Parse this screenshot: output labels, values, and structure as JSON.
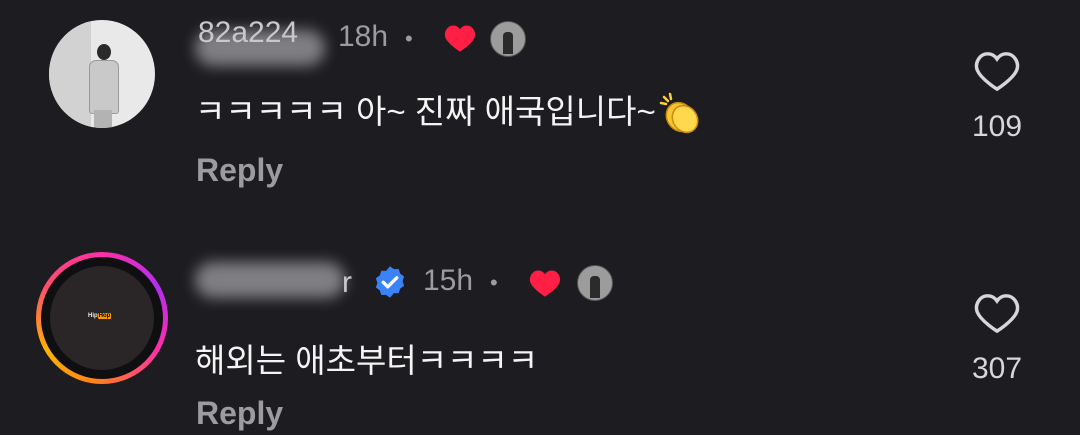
{
  "comments": [
    {
      "username_fragment": "82a224",
      "time": "18h",
      "separator": "•",
      "text": "ㅋㅋㅋㅋㅋ 아~ 진짜 애국입니다~",
      "emoji": "clapping-hands",
      "reply_label": "Reply",
      "likes": "109"
    },
    {
      "username_fragment": "r",
      "time": "15h",
      "separator": "•",
      "verified": true,
      "avatar_logo": [
        "Hip",
        "Hop"
      ],
      "text": "해외는 애초부터ㅋㅋㅋㅋ",
      "reply_label": "Reply",
      "likes": "307"
    }
  ],
  "colors": {
    "background": "#1d1d21",
    "heart": "#ff1f44",
    "verified": "#3b82f6",
    "muted": "#9b9ba0"
  }
}
